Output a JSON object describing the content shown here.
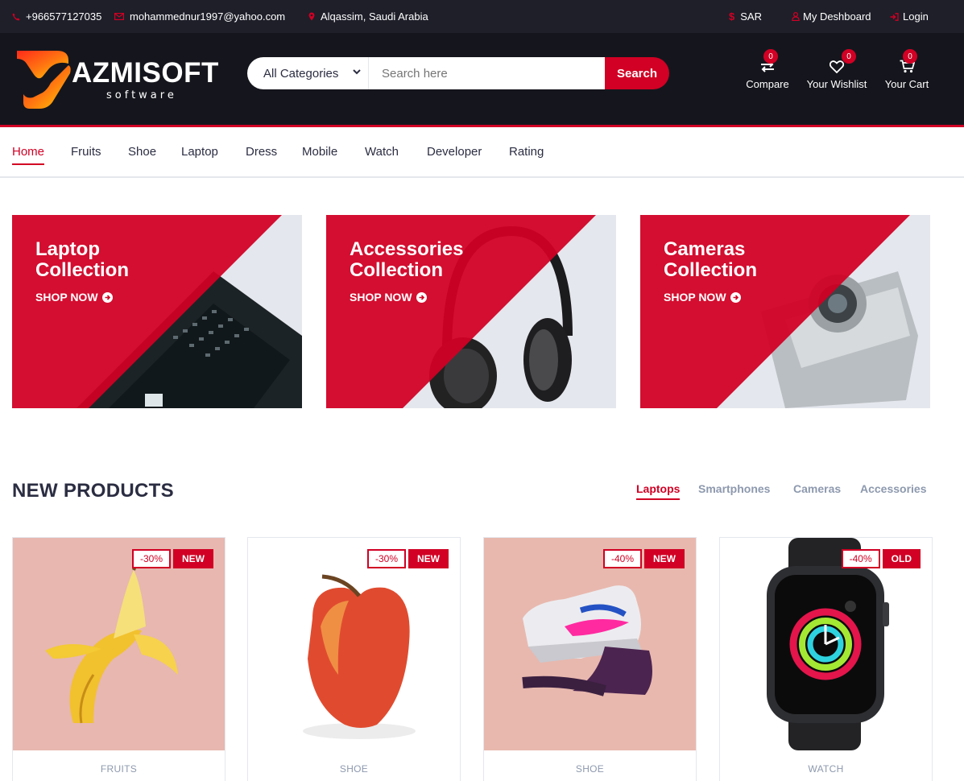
{
  "topbar": {
    "phone": "+966577127035",
    "email": "mohammednur1997@yahoo.com",
    "location": "Alqassim, Saudi Arabia",
    "currency": "SAR",
    "dashboard": "My Deshboard",
    "login": "Login"
  },
  "header": {
    "logo_word": "AZMISOFT",
    "logo_sub": "software",
    "category_select": "All Categories",
    "search_placeholder": "Search here",
    "search_button": "Search",
    "compare_label": "Compare",
    "compare_count": "0",
    "wishlist_label": "Your Wishlist",
    "wishlist_count": "0",
    "cart_label": "Your Cart",
    "cart_count": "0"
  },
  "nav": {
    "items": [
      "Home",
      "Fruits",
      "Shoe",
      "Laptop",
      "Dress",
      "Mobile",
      "Watch",
      "Developer",
      "Rating"
    ],
    "active": "Home"
  },
  "collections": [
    {
      "title": "Laptop\nCollection",
      "cta": "SHOP NOW"
    },
    {
      "title": "Accessories\nCollection",
      "cta": "SHOP NOW"
    },
    {
      "title": "Cameras\nCollection",
      "cta": "SHOP NOW"
    }
  ],
  "new_products": {
    "title": "NEW PRODUCTS",
    "tabs": [
      "Laptops",
      "Smartphones",
      "Cameras",
      "Accessories"
    ],
    "active_tab": "Laptops",
    "items": [
      {
        "discount": "-30%",
        "tag": "NEW",
        "category": "FRUITS"
      },
      {
        "discount": "-30%",
        "tag": "NEW",
        "category": "SHOE"
      },
      {
        "discount": "-40%",
        "tag": "NEW",
        "category": "SHOE"
      },
      {
        "discount": "-40%",
        "tag": "OLD",
        "category": "WATCH"
      }
    ]
  },
  "colors": {
    "primary": "#d10024",
    "topbar": "#1e1f29",
    "header": "#15161d",
    "muted": "#8d99ae"
  }
}
